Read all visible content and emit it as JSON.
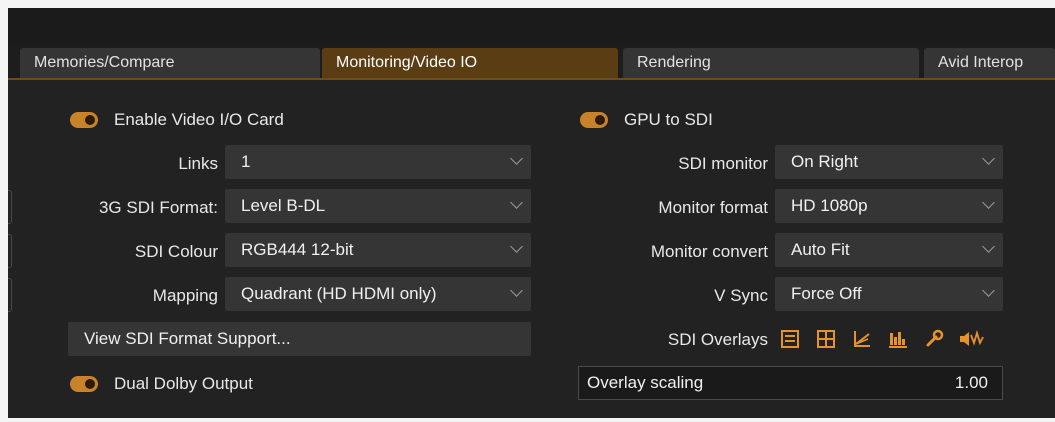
{
  "tabs": [
    {
      "label": "Memories/Compare",
      "active": false
    },
    {
      "label": "Monitoring/Video IO",
      "active": true
    },
    {
      "label": "Rendering",
      "active": false
    },
    {
      "label": "Avid Interop",
      "active": false
    }
  ],
  "left": {
    "enable_video_io": {
      "label": "Enable Video I/O Card",
      "on": true
    },
    "links": {
      "label": "Links",
      "value": "1"
    },
    "sdi_format": {
      "label": "3G SDI Format:",
      "value": "Level B-DL"
    },
    "sdi_colour": {
      "label": "SDI Colour",
      "value": "RGB444 12-bit"
    },
    "mapping": {
      "label": "Mapping",
      "value": "Quadrant (HD HDMI only)"
    },
    "view_support_button": "View SDI Format Support...",
    "dual_dolby": {
      "label": "Dual Dolby Output",
      "on": true
    }
  },
  "right": {
    "gpu_to_sdi": {
      "label": "GPU to SDI",
      "on": true
    },
    "sdi_monitor": {
      "label": "SDI monitor",
      "value": "On Right"
    },
    "monitor_format": {
      "label": "Monitor format",
      "value": "HD 1080p"
    },
    "monitor_convert": {
      "label": "Monitor convert",
      "value": "Auto Fit"
    },
    "v_sync": {
      "label": "V Sync",
      "value": "Force Off"
    },
    "sdi_overlays": {
      "label": "SDI Overlays",
      "icons": [
        "list-overlay-icon",
        "grid-overlay-icon",
        "scope-overlay-icon",
        "histogram-overlay-icon",
        "wrench-overlay-icon",
        "audio-overlay-icon"
      ]
    },
    "overlay_scaling": {
      "label": "Overlay scaling",
      "value": "1.00"
    }
  },
  "colors": {
    "accent": "#c8822a",
    "active_tab": "#5b3d13",
    "control_bg": "#353535",
    "panel_bg": "#222222"
  }
}
